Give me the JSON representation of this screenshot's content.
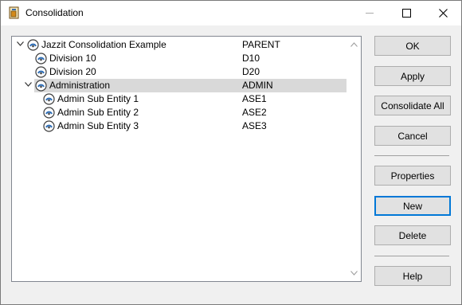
{
  "window": {
    "title": "Consolidation",
    "app_icon": "consolidation-app-icon",
    "controls": {
      "minimize": "minimize-icon",
      "maximize": "maximize-icon",
      "close": "close-icon"
    }
  },
  "tree": {
    "items": [
      {
        "label": "Jazzit Consolidation Example",
        "code": "PARENT",
        "level": 0,
        "expanded": true,
        "selected": false
      },
      {
        "label": "Division 10",
        "code": "D10",
        "level": 1,
        "expanded": null,
        "selected": false
      },
      {
        "label": "Division 20",
        "code": "D20",
        "level": 1,
        "expanded": null,
        "selected": false
      },
      {
        "label": "Administration",
        "code": "ADMIN",
        "level": 1,
        "expanded": true,
        "selected": true
      },
      {
        "label": "Admin Sub Entity 1",
        "code": "ASE1",
        "level": 2,
        "expanded": null,
        "selected": false
      },
      {
        "label": "Admin Sub Entity 2",
        "code": "ASE2",
        "level": 2,
        "expanded": null,
        "selected": false
      },
      {
        "label": "Admin Sub Entity 3",
        "code": "ASE3",
        "level": 2,
        "expanded": null,
        "selected": false
      }
    ]
  },
  "buttons": {
    "ok": "OK",
    "apply": "Apply",
    "consolidate_all": "Consolidate All",
    "cancel": "Cancel",
    "properties": "Properties",
    "new": "New",
    "delete": "Delete",
    "help": "Help"
  },
  "colors": {
    "focus_border": "#0078d7",
    "selection": "#d9d9d9"
  }
}
